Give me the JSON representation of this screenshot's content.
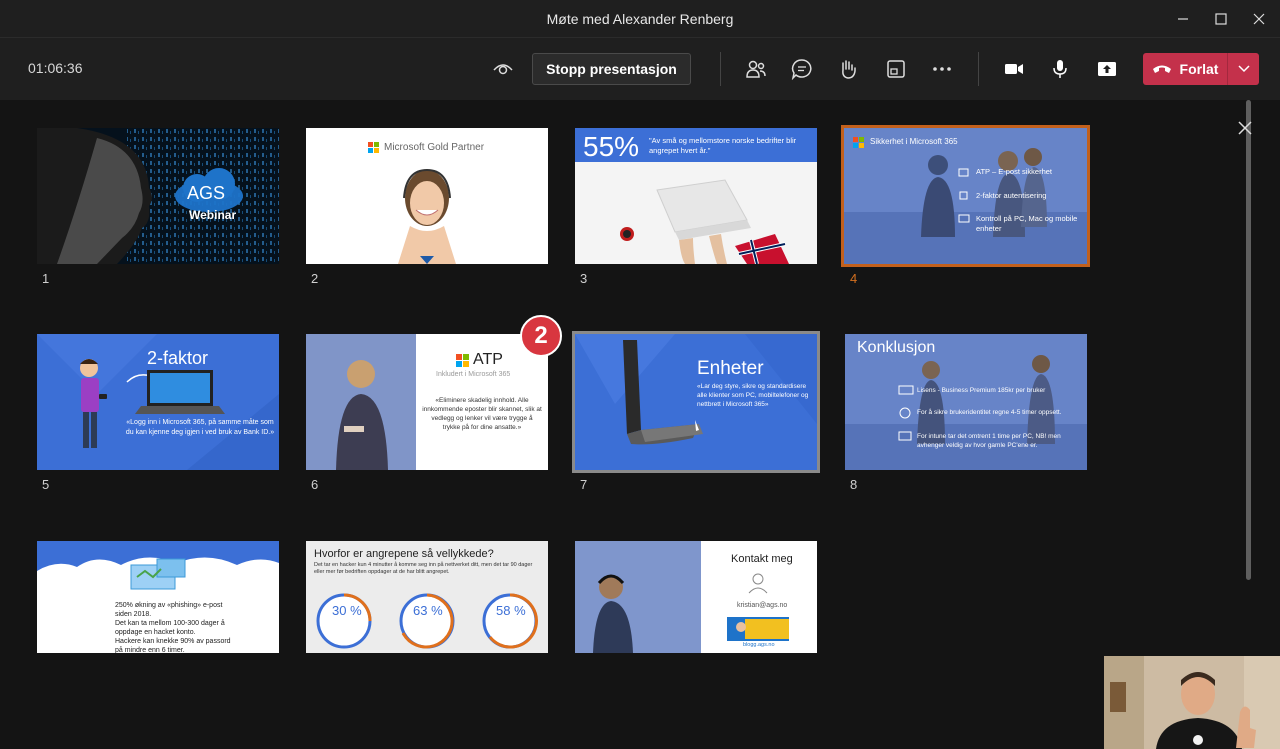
{
  "window": {
    "title": "Møte med Alexander Renberg"
  },
  "toolbar": {
    "timer": "01:06:36",
    "stop_label": "Stopp presentasjon",
    "leave_label": "Forlat"
  },
  "slides": [
    {
      "num": "1",
      "caption": "AGS",
      "subcaption": "Webinar"
    },
    {
      "num": "2",
      "caption": "Microsoft Gold Partner"
    },
    {
      "num": "3",
      "headline": "55%",
      "caption": "\"Av små og mellomstore norske bedrifter blir angrepet hvert år.\""
    },
    {
      "num": "4",
      "title": "Sikkerhet i Microsoft 365",
      "items": [
        "ATP – E-post sikkerhet",
        "2-faktor autentisering",
        "Kontroll på PC, Mac og mobile enheter"
      ]
    },
    {
      "num": "5",
      "title": "2-faktor",
      "caption": "«Logg inn i Microsoft 365, på samme måte som du kan kjenne deg igjen i ved bruk av Bank ID.»"
    },
    {
      "num": "6",
      "title": "ATP",
      "subtitle": "Inkludert i Microsoft 365",
      "caption": "«Eliminere skadelig innhold. Alle innkommende eposter blir skannet, slik at vedlegg og lenker vil være trygge å trykke på for dine ansatte.»"
    },
    {
      "num": "7",
      "title": "Enheter",
      "caption": "«Lar deg styre, sikre og standardisere alle klienter som PC, mobiltelefoner og nettbrett i Microsoft 365»"
    },
    {
      "num": "8",
      "title": "Konklusjon",
      "items": [
        "Lisens - Business Premium 185kr per bruker",
        "For å sikre brukeridentitet regne 4-5 timer oppsett.",
        "For intune tar det omtrent 1 time per PC, NB! men avhenger veldig av hvor gamle PC'ene er."
      ]
    },
    {
      "num": "",
      "items": [
        "250% økning av «phishing» e-post siden 2018.",
        "Det kan ta mellom 100-300 dager å oppdage en hacket konto.",
        "Hackere kan knekke 90% av passord på mindre enn 6 timer."
      ]
    },
    {
      "num": "",
      "title": "Hvorfor er angrepene så vellykkede?",
      "caption": "Det tar en hacker kun 4 minutter å komme seg inn på nettverket ditt, men det tar 90 dager eller mer før bedriften oppdager at de har blitt angrepet.",
      "stats": [
        "30 %",
        "63 %",
        "58 %"
      ]
    },
    {
      "num": "",
      "title": "Kontakt meg",
      "email": "kristian@ags.no",
      "footer": "blogg.ags.no"
    }
  ],
  "badge": {
    "label": "2"
  },
  "colors": {
    "accent": "#c2601c",
    "leave": "#c4314b",
    "slide_blue": "#3c6fd6"
  }
}
